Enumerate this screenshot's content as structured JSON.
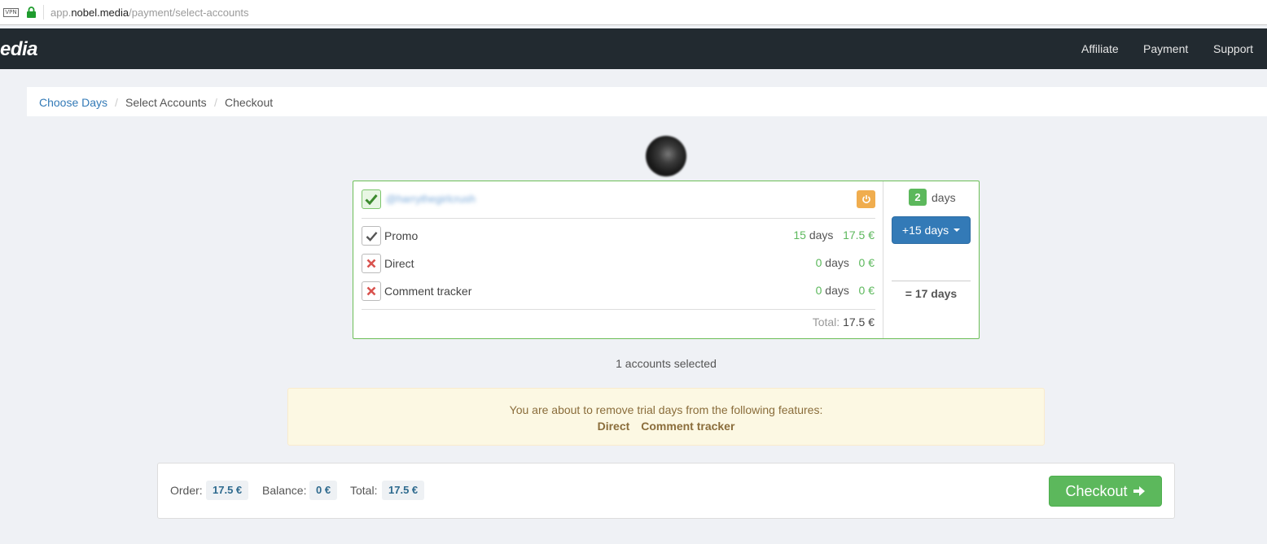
{
  "browser": {
    "url_host": "app.",
    "url_domain": "nobel.media",
    "url_path": "/payment/select-accounts",
    "vpn_label": "VPN"
  },
  "navbar": {
    "brand": "edia",
    "links": [
      "Affiliate",
      "Payment",
      "Support"
    ]
  },
  "breadcrumb": {
    "items": [
      "Choose Days",
      "Select Accounts",
      "Checkout"
    ],
    "separator": "/"
  },
  "account": {
    "handle": "@harrythegirlcrush",
    "checked": true,
    "trial_days": "2",
    "trial_days_label": "days",
    "add_days_label": "+15 days",
    "result_days": "= 17 days",
    "features": [
      {
        "name": "Promo",
        "enabled": true,
        "days": "15",
        "days_label": "days",
        "price": "17.5 €"
      },
      {
        "name": "Direct",
        "enabled": false,
        "days": "0",
        "days_label": "days",
        "price": "0 €"
      },
      {
        "name": "Comment tracker",
        "enabled": false,
        "days": "0",
        "days_label": "days",
        "price": "0 €"
      }
    ],
    "total_label": "Total:",
    "total_value": "17.5 €"
  },
  "accounts_selected": "1 accounts selected",
  "warning": {
    "message": "You are about to remove trial days from the following features:",
    "features": [
      "Direct",
      "Comment tracker"
    ]
  },
  "summary": {
    "order_label": "Order:",
    "order_value": "17.5 €",
    "balance_label": "Balance:",
    "balance_value": "0 €",
    "total_label": "Total:",
    "total_value": "17.5 €",
    "checkout_label": "Checkout"
  },
  "colors": {
    "navbar_bg": "#222a30",
    "primary": "#337ab7",
    "success": "#5cb85c",
    "warning": "#f0ad4e",
    "danger": "#d9534f"
  }
}
